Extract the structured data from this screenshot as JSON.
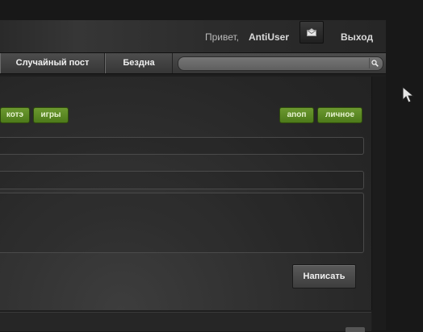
{
  "header": {
    "greeting_prefix": "Привет,",
    "username": "AntiUser",
    "mail_icon": "envelope-icon",
    "logout_label": "Выход"
  },
  "nav": {
    "items": [
      {
        "label": "Случайный пост"
      },
      {
        "label": "Бездна"
      }
    ]
  },
  "search": {
    "placeholder": "",
    "button_icon": "search-icon"
  },
  "editor": {
    "tags_left": [
      {
        "label": "котэ"
      },
      {
        "label": "игры"
      }
    ],
    "tags_right": [
      {
        "label": "аnоп"
      },
      {
        "label": "личное"
      }
    ],
    "title_value": "",
    "tags_value": "",
    "body_value": "",
    "submit_label": "Написать"
  },
  "colors": {
    "background": "#181818",
    "panel": "#2b2b2b",
    "tag_green": "#5f8c24",
    "nav_gray": "#454545"
  }
}
